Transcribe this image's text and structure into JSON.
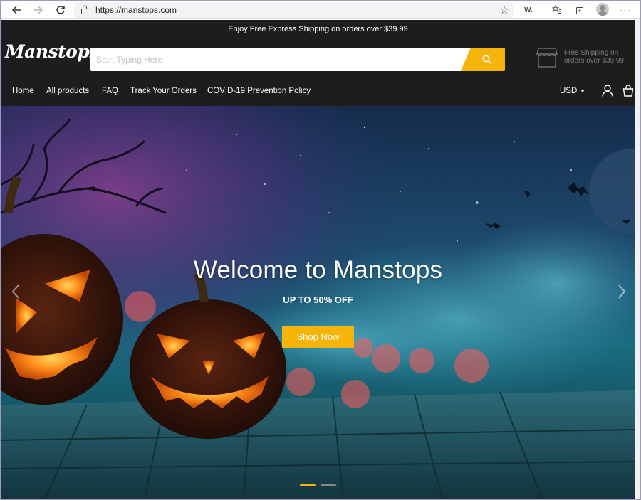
{
  "browser": {
    "url": "https://manstops.com",
    "back_icon": "arrow-left-icon",
    "forward_icon": "arrow-right-icon",
    "refresh_icon": "refresh-icon",
    "favorite_icon": "star-icon",
    "extension_label": "W.",
    "menu_icon": "ellipsis-icon"
  },
  "site": {
    "announcement": "Enjoy Free Express Shipping on orders over $39.99",
    "logo": "Manstops",
    "search": {
      "placeholder": "Start Typing Here"
    },
    "shipping_note": "Free Shipping on orders over $39.99",
    "nav": {
      "items": [
        {
          "label": "Home"
        },
        {
          "label": "All products"
        },
        {
          "label": "FAQ"
        },
        {
          "label": "Track Your Orders"
        },
        {
          "label": "COVID-19 Prevention Policy"
        }
      ],
      "currency": "USD"
    }
  },
  "hero": {
    "title": "Welcome to Manstops",
    "subtitle": "UP TO 50% OFF",
    "button": "Shop Now",
    "active_slide": 1,
    "slide_count": 2
  },
  "colors": {
    "accent": "#f5b40a",
    "header_bg": "#1d1d1d",
    "inactive_dot": "#8a8a8a"
  }
}
